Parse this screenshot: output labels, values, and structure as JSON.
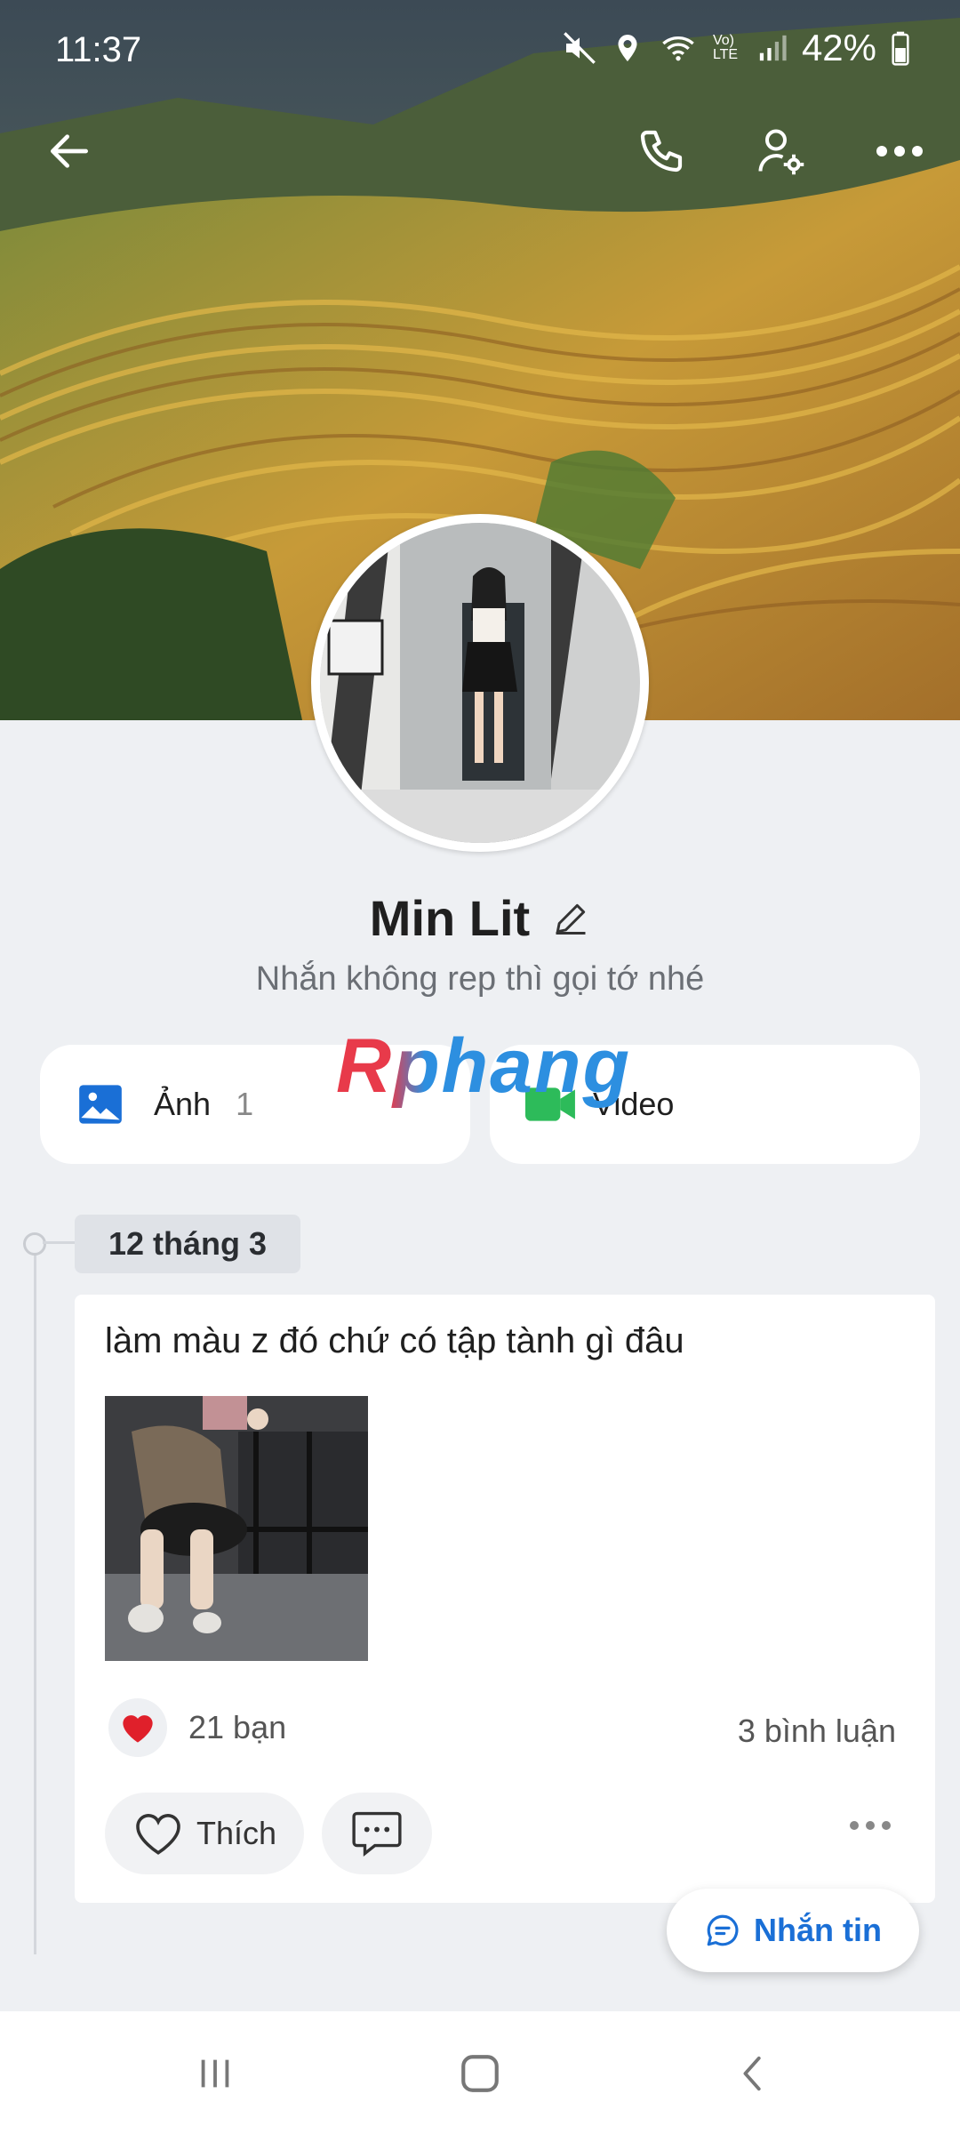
{
  "status_bar": {
    "time": "11:37",
    "battery": "42%",
    "network": "Vo) LTE"
  },
  "profile": {
    "name": "Min Lit",
    "bio": "Nhắn không rep thì gọi tớ nhé"
  },
  "media": {
    "photos_label": "Ảnh",
    "photos_count": "1",
    "video_label": "Video"
  },
  "watermark": "Rphang",
  "timeline": {
    "date": "12 tháng 3",
    "post": {
      "text": "làm màu z đó chứ có tập tành gì đâu",
      "reactions": "21 bạn",
      "comments": "3 bình luận",
      "like_label": "Thích"
    }
  },
  "fab": {
    "label": "Nhắn tin"
  },
  "colors": {
    "accent": "#1a6fd6",
    "video_green": "#2dbb5a",
    "heart": "#e0202b"
  },
  "icons": [
    "back-icon",
    "phone-icon",
    "user-settings-icon",
    "more-icon",
    "pencil-icon",
    "photo-icon",
    "video-icon",
    "heart-icon",
    "comment-icon",
    "chat-icon"
  ]
}
